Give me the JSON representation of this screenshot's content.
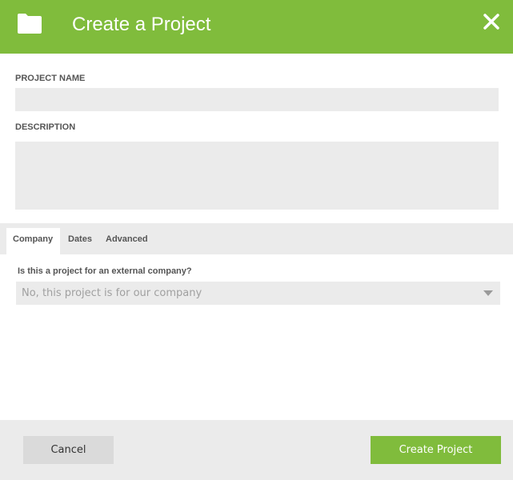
{
  "header": {
    "title": "Create a Project",
    "icons": {
      "left": "folder-icon",
      "right": "close-icon"
    }
  },
  "form": {
    "project_name": {
      "label": "PROJECT NAME",
      "value": "",
      "placeholder": ""
    },
    "description": {
      "label": "DESCRIPTION",
      "value": "",
      "placeholder": ""
    }
  },
  "tabs": [
    {
      "label": "Company",
      "active": true
    },
    {
      "label": "Dates",
      "active": false
    },
    {
      "label": "Advanced",
      "active": false
    }
  ],
  "company": {
    "question": "Is this a project for an external company?",
    "selected": "No, this project is for our company"
  },
  "footer": {
    "cancel_label": "Cancel",
    "create_label": "Create Project"
  },
  "colors": {
    "accent": "#80bc3c",
    "field_bg": "#ebebeb",
    "cancel_bg": "#dadada",
    "label_text": "#555555"
  }
}
